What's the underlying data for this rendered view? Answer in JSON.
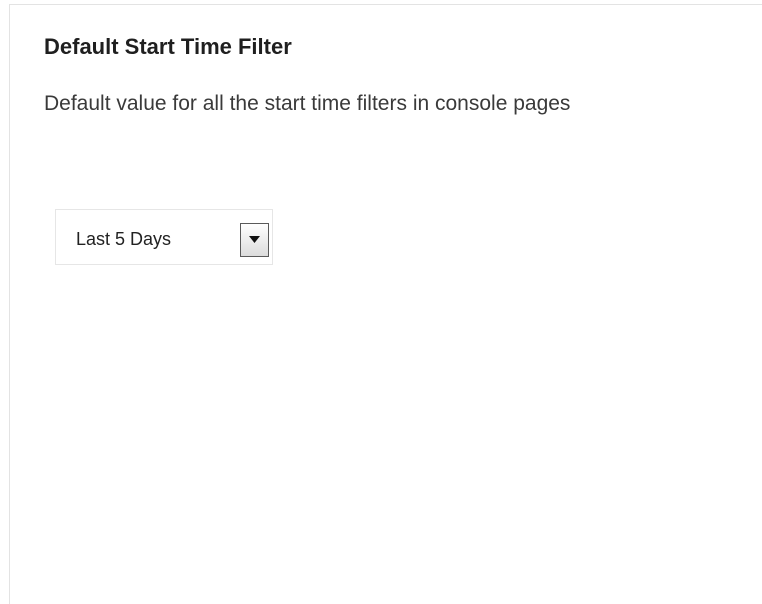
{
  "section": {
    "title": "Default Start Time Filter",
    "description": "Default value for all the start time filters in console pages"
  },
  "filter_select": {
    "selected": "Last 5 Days",
    "arrow_icon": "chevron-down-icon"
  }
}
